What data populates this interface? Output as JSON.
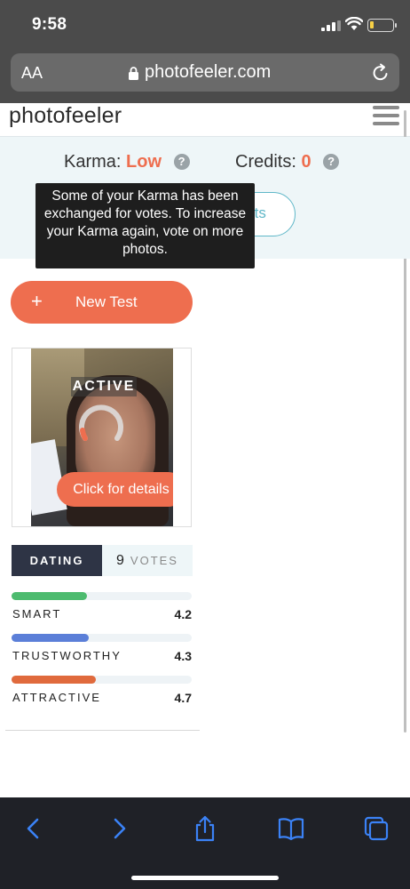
{
  "status_bar": {
    "time": "9:58"
  },
  "browser": {
    "text_size_label": "AA",
    "url": "photofeeler.com"
  },
  "header": {
    "logo": "photofeeler"
  },
  "karma": {
    "label": "Karma:",
    "value": "Low"
  },
  "credits": {
    "label": "Credits:",
    "value": "0"
  },
  "tooltip": {
    "text": "Some of your Karma has been exchanged for votes. To increase your Karma again, vote on more photos."
  },
  "buy_button": {
    "label": "Credits"
  },
  "new_test": {
    "icon": "+",
    "label": "New Test"
  },
  "test_card": {
    "status": "ACTIVE",
    "details_label": "Click for details"
  },
  "tabs": {
    "category": "DATING",
    "votes_count": "9",
    "votes_label": "VOTES"
  },
  "metrics": [
    {
      "name": "SMART",
      "score": "4.2",
      "fraction": 0.42,
      "color": "#4dbb6f"
    },
    {
      "name": "TRUSTWORTHY",
      "score": "4.3",
      "fraction": 0.43,
      "color": "#5b7fd8"
    },
    {
      "name": "ATTRACTIVE",
      "score": "4.7",
      "fraction": 0.47,
      "color": "#e06a3d"
    }
  ],
  "colors": {
    "accent": "#ee6e4f",
    "dark_tab": "#2e3445",
    "teal": "#5fb7c8"
  },
  "toolbar_icons": [
    "back-icon",
    "forward-icon",
    "share-icon",
    "bookmarks-icon",
    "tabs-icon"
  ]
}
